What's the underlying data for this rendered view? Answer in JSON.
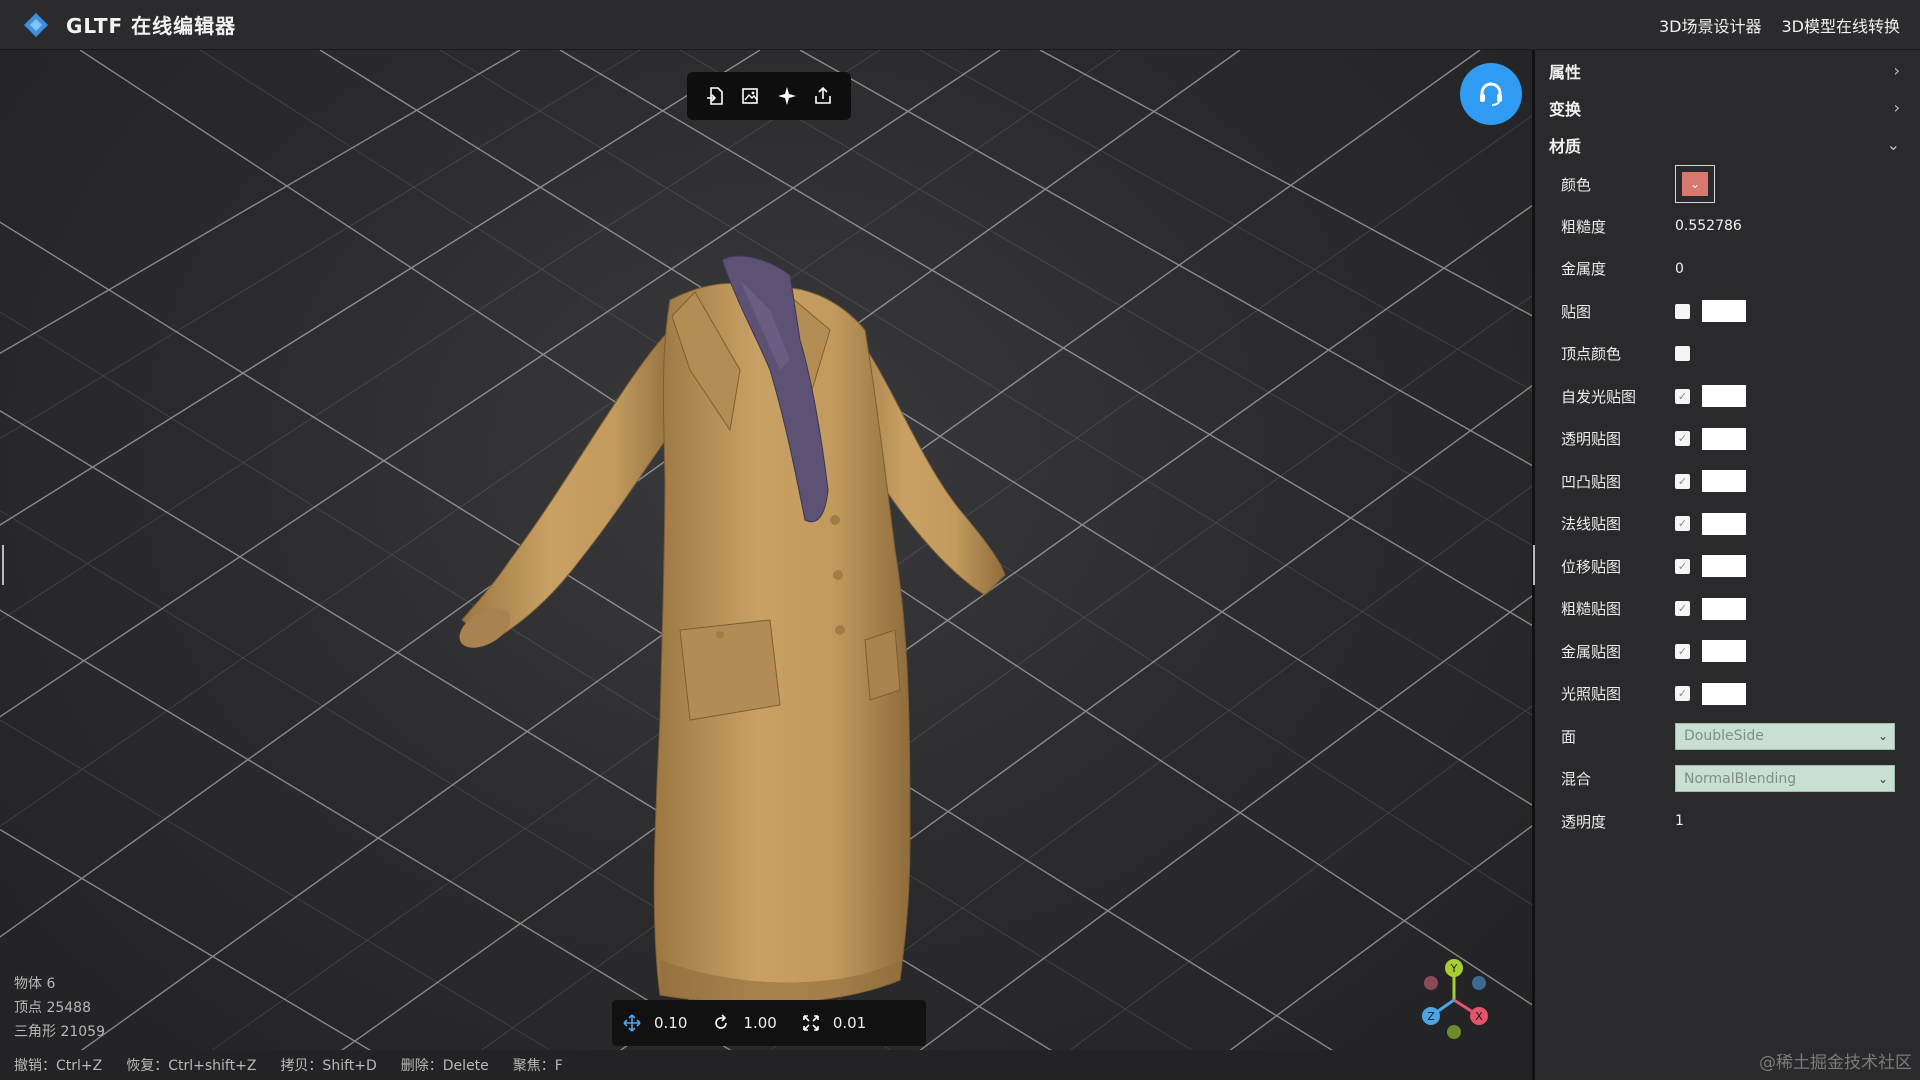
{
  "app": {
    "title": "GLTF 在线编辑器",
    "links": [
      "3D场景设计器",
      "3D模型在线转换"
    ]
  },
  "toolbar": {
    "icons": [
      "import-icon",
      "image-export-icon",
      "light-icon",
      "export-icon"
    ]
  },
  "stats": {
    "objects": "物体 6",
    "vertices": "顶点 25488",
    "triangles": "三角形 21059"
  },
  "shortcuts": [
    "撤销：Ctrl+Z",
    "恢复：Ctrl+shift+Z",
    "拷贝：Shift+D",
    "删除：Delete",
    "聚焦：F"
  ],
  "transform": {
    "move": "0.10",
    "rotate": "1.00",
    "scale": "0.01"
  },
  "gizmo": {
    "x": "X",
    "y": "Y",
    "z": "Z",
    "colors": {
      "x": "#e2556a",
      "y": "#a8cf2e",
      "z": "#4aa6e6"
    }
  },
  "panel": {
    "sections": {
      "properties": "属性",
      "transform": "变换",
      "material": "材质"
    },
    "material": {
      "color_label": "颜色",
      "color_value": "#d8786e",
      "roughness_label": "粗糙度",
      "roughness_value": "0.552786",
      "metalness_label": "金属度",
      "metalness_value": "0",
      "map_label": "贴图",
      "vertex_colors_label": "顶点颜色",
      "maps": [
        {
          "label": "自发光贴图",
          "checked": true
        },
        {
          "label": "透明贴图",
          "checked": true
        },
        {
          "label": "凹凸贴图",
          "checked": true
        },
        {
          "label": "法线贴图",
          "checked": true
        },
        {
          "label": "位移贴图",
          "checked": true
        },
        {
          "label": "粗糙贴图",
          "checked": true
        },
        {
          "label": "金属贴图",
          "checked": true
        },
        {
          "label": "光照贴图",
          "checked": true
        }
      ],
      "side_label": "面",
      "side_value": "DoubleSide",
      "blending_label": "混合",
      "blending_value": "NormalBlending",
      "opacity_label": "透明度",
      "opacity_value": "1"
    }
  },
  "watermark": "@稀土掘金技术社区",
  "colors": {
    "accent": "#2f9bf2",
    "panel_bg": "#2a2a2c",
    "coat": "#c49a5c",
    "scarf": "#5d5274"
  }
}
